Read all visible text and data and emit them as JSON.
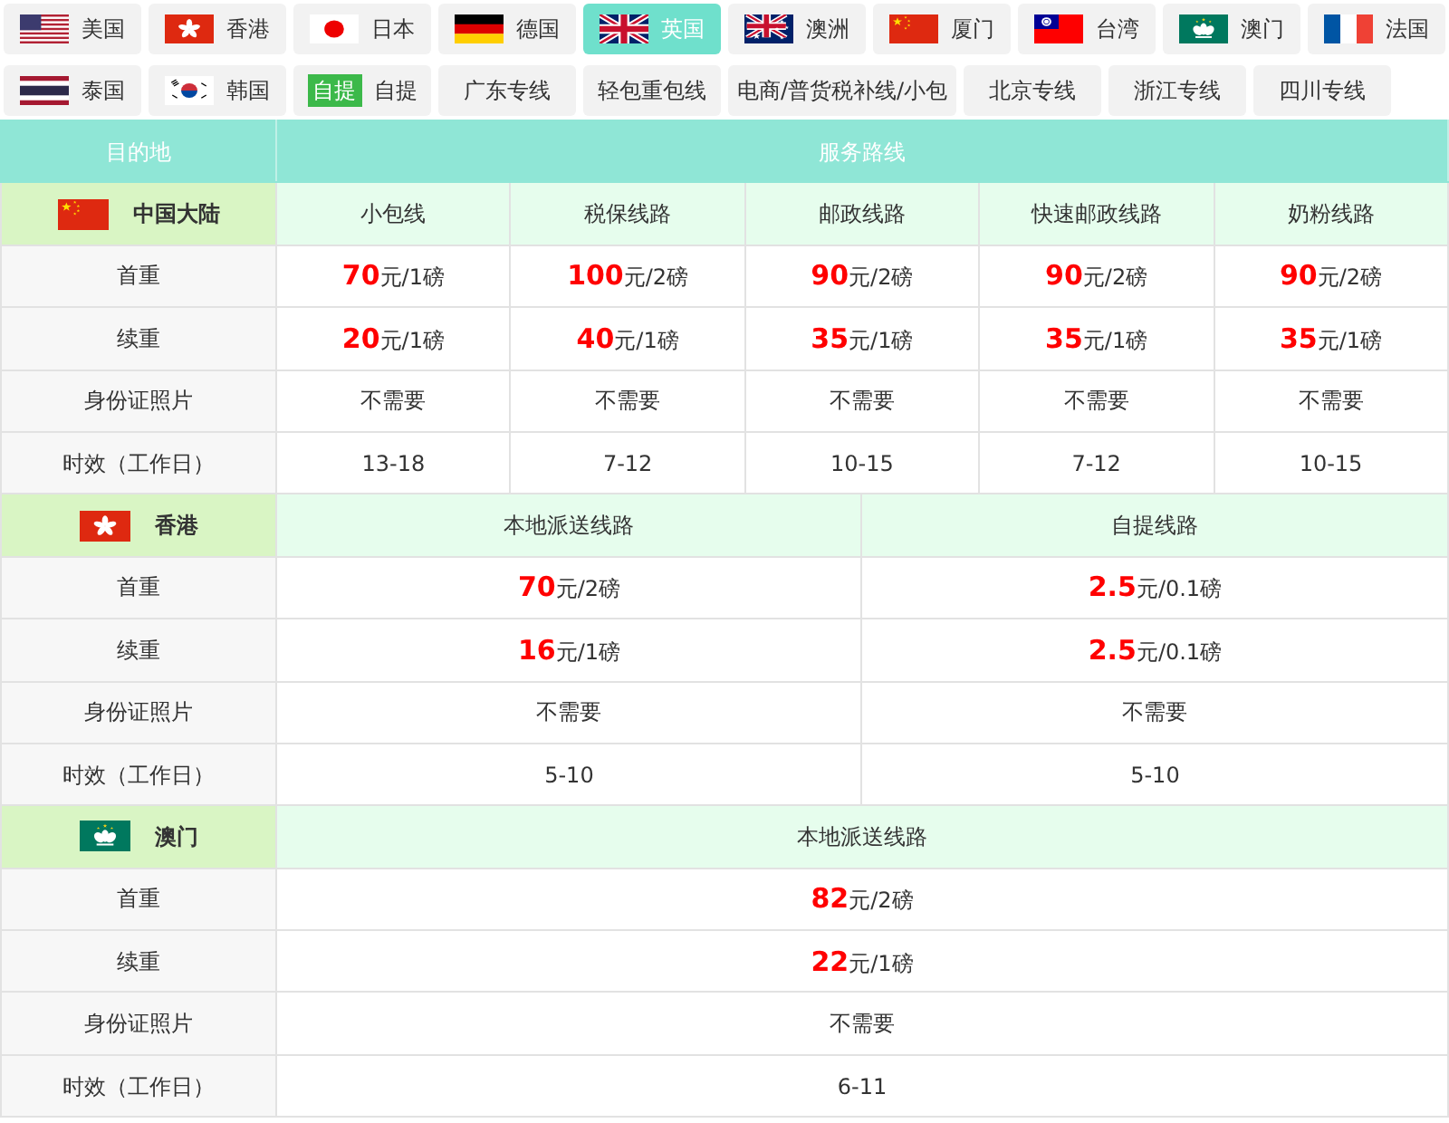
{
  "tabs": [
    {
      "label": "美国",
      "kind": "us",
      "selected": false
    },
    {
      "label": "香港",
      "kind": "hk",
      "selected": false
    },
    {
      "label": "日本",
      "kind": "jp",
      "selected": false
    },
    {
      "label": "德国",
      "kind": "de",
      "selected": false
    },
    {
      "label": "英国",
      "kind": "gb",
      "selected": true
    },
    {
      "label": "澳洲",
      "kind": "au",
      "selected": false
    },
    {
      "label": "厦门",
      "kind": "cn",
      "selected": false
    },
    {
      "label": "台湾",
      "kind": "tw",
      "selected": false
    },
    {
      "label": "澳门",
      "kind": "mo",
      "selected": false
    },
    {
      "label": "法国",
      "kind": "fr",
      "selected": false
    },
    {
      "label": "泰国",
      "kind": "th",
      "selected": false
    },
    {
      "label": "韩国",
      "kind": "kr",
      "selected": false
    },
    {
      "label": "自提",
      "kind": "badge",
      "badge": "自提",
      "selected": false
    },
    {
      "label": "广东专线",
      "kind": "text",
      "selected": false
    },
    {
      "label": "轻包重包线",
      "kind": "text",
      "selected": false
    },
    {
      "label": "电商/普货税补线/小包",
      "kind": "text",
      "selected": false
    },
    {
      "label": "北京专线",
      "kind": "text",
      "selected": false
    },
    {
      "label": "浙江专线",
      "kind": "text",
      "selected": false
    },
    {
      "label": "四川专线",
      "kind": "text",
      "selected": false
    }
  ],
  "table": {
    "columns": [
      "目的地",
      "服务路线"
    ],
    "sections": [
      {
        "region": "中国大陆",
        "kind": "cn",
        "routes": [
          "小包线",
          "税保线路",
          "邮政线路",
          "快速邮政线路",
          "奶粉线路"
        ],
        "rows": [
          {
            "label": "首重",
            "values": [
              "**70**元/1磅",
              "**100**元/2磅",
              "**90**元/2磅",
              "**90**元/2磅",
              "**90**元/2磅"
            ]
          },
          {
            "label": "续重",
            "values": [
              "**20**元/1磅",
              "**40**元/1磅",
              "**35**元/1磅",
              "**35**元/1磅",
              "**35**元/1磅"
            ]
          },
          {
            "label": "身份证照片",
            "values": [
              "不需要",
              "不需要",
              "不需要",
              "不需要",
              "不需要"
            ]
          },
          {
            "label": "时效（工作日）",
            "values": [
              "13-18",
              "7-12",
              "10-15",
              "7-12",
              "10-15"
            ]
          }
        ]
      },
      {
        "region": "香港",
        "kind": "hk",
        "routes": [
          "本地派送线路",
          "自提线路"
        ],
        "rows": [
          {
            "label": "首重",
            "values": [
              "**70**元/2磅",
              "**2.5**元/0.1磅"
            ]
          },
          {
            "label": "续重",
            "values": [
              "**16**元/1磅",
              "**2.5**元/0.1磅"
            ]
          },
          {
            "label": "身份证照片",
            "values": [
              "不需要",
              "不需要"
            ]
          },
          {
            "label": "时效（工作日）",
            "values": [
              "5-10",
              "5-10"
            ]
          }
        ]
      },
      {
        "region": "澳门",
        "kind": "mo",
        "routes": [
          "本地派送线路"
        ],
        "rows": [
          {
            "label": "首重",
            "values": [
              "**82**元/2磅"
            ]
          },
          {
            "label": "续重",
            "values": [
              "**22**元/1磅"
            ]
          },
          {
            "label": "身份证照片",
            "values": [
              "不需要"
            ]
          },
          {
            "label": "时效（工作日）",
            "values": [
              "6-11"
            ]
          }
        ]
      }
    ]
  }
}
